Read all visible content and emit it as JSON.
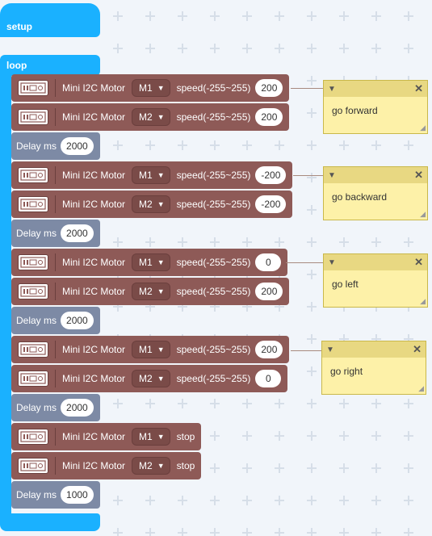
{
  "setup": {
    "label": "setup"
  },
  "loop": {
    "label": "loop"
  },
  "motor_label": "Mini I2C Motor",
  "speed_label": "speed(-255~255)",
  "stop_label": "stop",
  "delay_label": "Delay ms",
  "rows": [
    {
      "motor": "M1",
      "speed": "200"
    },
    {
      "motor": "M2",
      "speed": "200"
    },
    {
      "delay": "2000"
    },
    {
      "motor": "M1",
      "speed": "-200"
    },
    {
      "motor": "M2",
      "speed": "-200"
    },
    {
      "delay": "2000"
    },
    {
      "motor": "M1",
      "speed": "0"
    },
    {
      "motor": "M2",
      "speed": "200"
    },
    {
      "delay": "2000"
    },
    {
      "motor": "M1",
      "speed": "200"
    },
    {
      "motor": "M2",
      "speed": "0"
    },
    {
      "delay": "2000"
    },
    {
      "motor": "M1"
    },
    {
      "motor": "M2"
    },
    {
      "delay": "1000"
    }
  ],
  "comments": [
    "go forward",
    "go backward",
    "go left",
    "go right"
  ],
  "colors": {
    "event": "#1ab1ff",
    "motor": "#8e5a57",
    "delay": "#7d8aa5",
    "comment": "#fdf1a8"
  }
}
